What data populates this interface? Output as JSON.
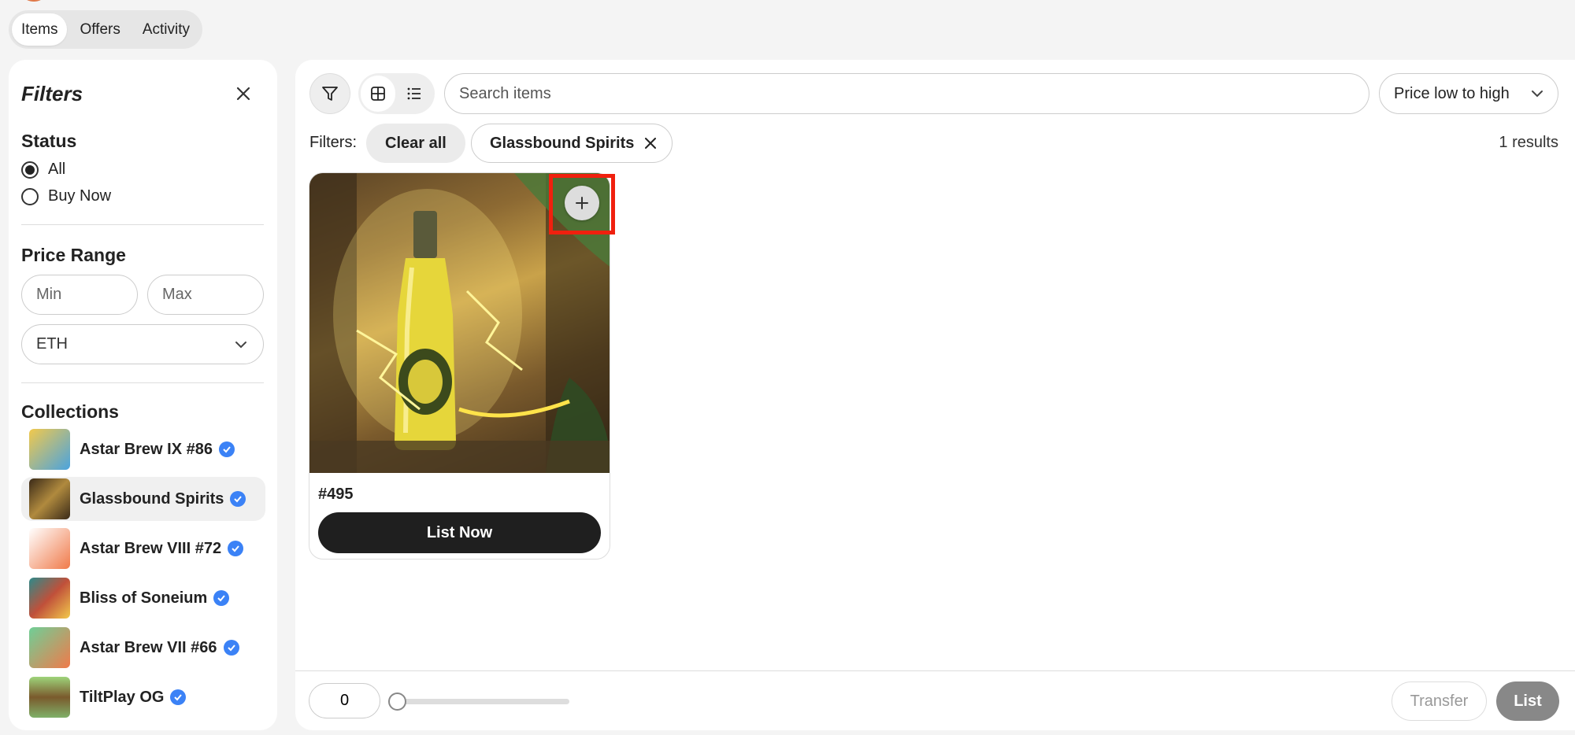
{
  "tabs": [
    {
      "label": "Items",
      "active": true
    },
    {
      "label": "Offers",
      "active": false
    },
    {
      "label": "Activity",
      "active": false
    }
  ],
  "sidebar": {
    "title": "Filters",
    "status": {
      "title": "Status",
      "options": [
        {
          "label": "All",
          "checked": true
        },
        {
          "label": "Buy Now",
          "checked": false
        }
      ]
    },
    "price_range": {
      "title": "Price Range",
      "min_placeholder": "Min",
      "max_placeholder": "Max",
      "currency": "ETH"
    },
    "collections": {
      "title": "Collections",
      "items": [
        {
          "name": "Astar Brew IX #86",
          "selected": false,
          "thumb_color": "#f2c94c"
        },
        {
          "name": "Glassbound Spirits",
          "selected": true,
          "thumb_color": "#8a6a2e"
        },
        {
          "name": "Astar Brew VIII #72",
          "selected": false,
          "thumb_color": "#f07a4a"
        },
        {
          "name": "Bliss of Soneium",
          "selected": false,
          "thumb_color": "#c0503a"
        },
        {
          "name": "Astar Brew VII #66",
          "selected": false,
          "thumb_color": "#6fcf97"
        },
        {
          "name": "TiltPlay OG",
          "selected": false,
          "thumb_color": "#7fb069"
        }
      ]
    }
  },
  "main": {
    "search_placeholder": "Search items",
    "sort_label": "Price low to high",
    "filters_label": "Filters:",
    "clear_all": "Clear all",
    "active_filter": "Glassbound Spirits",
    "results": "1 results",
    "card": {
      "title": "#495",
      "button": "List Now"
    },
    "bottom": {
      "count": "0",
      "transfer": "Transfer",
      "list": "List"
    }
  },
  "colors": {
    "accent_dark": "#1f1f1f",
    "verified": "#3b82f6",
    "highlight": "#f0200e"
  }
}
